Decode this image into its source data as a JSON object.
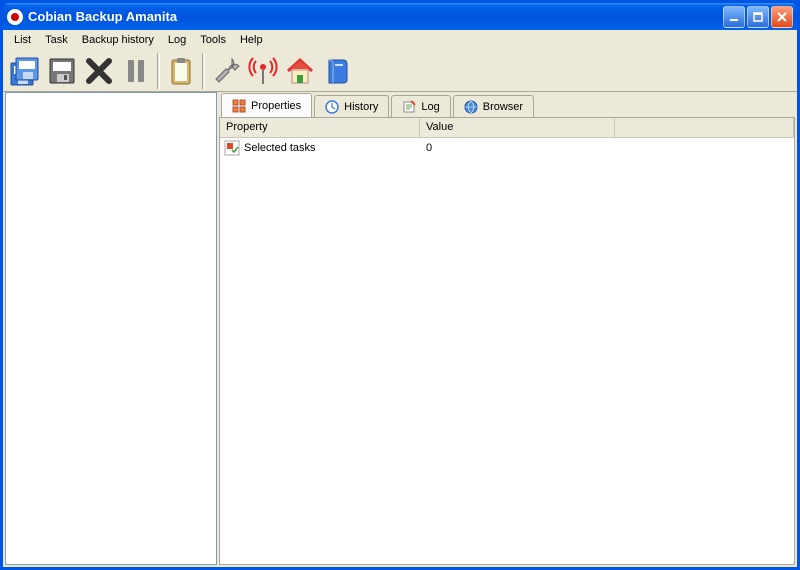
{
  "title": "Cobian Backup Amanita",
  "menu": {
    "list": "List",
    "task": "Task",
    "history": "Backup history",
    "log": "Log",
    "tools": "Tools",
    "help": "Help"
  },
  "tabs": {
    "properties": "Properties",
    "history": "History",
    "log": "Log",
    "browser": "Browser"
  },
  "columns": {
    "property": "Property",
    "value": "Value"
  },
  "rows": [
    {
      "label": "Selected tasks",
      "value": "0"
    }
  ]
}
